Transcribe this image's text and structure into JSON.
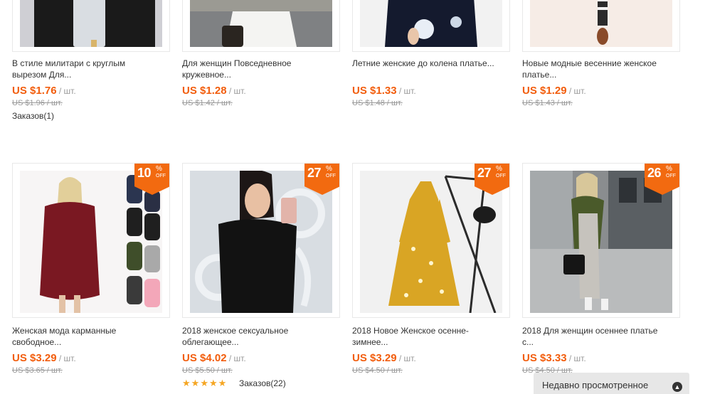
{
  "row1": [
    {
      "title": "В стиле милитари с круглым\nвырезом Для...",
      "price": "US $1.76",
      "unit": " / шт.",
      "old_price": "US $1.96 / шт.",
      "orders": "Заказов(1)"
    },
    {
      "title": "Для женщин Повседневное\nкружевное...",
      "price": "US $1.28",
      "unit": " / шт.",
      "old_price": "US $1.42 / шт."
    },
    {
      "title": "Летние женские до колена платье...",
      "price": "US $1.33",
      "unit": " / шт.",
      "old_price": "US $1.48 / шт."
    },
    {
      "title": "Новые модные весенние женское\nплатье...",
      "price": "US $1.29",
      "unit": " / шт.",
      "old_price": "US $1.43 / шт."
    }
  ],
  "row2": [
    {
      "badge_num": "10",
      "badge_pct": "%",
      "badge_off": "OFF",
      "title": "Женская мода карманные\nсвободное...",
      "price": "US $3.29",
      "unit": " / шт.",
      "old_price": "US $3.65 / шт."
    },
    {
      "badge_num": "27",
      "badge_pct": "%",
      "badge_off": "OFF",
      "title": "2018 женское сексуальное\nоблегающее...",
      "price": "US $4.02",
      "unit": " / шт.",
      "old_price": "US $5.50 / шт.",
      "rating": 5,
      "orders": "Заказов(22)"
    },
    {
      "badge_num": "27",
      "badge_pct": "%",
      "badge_off": "OFF",
      "title": "2018 Новое Женское осенне-\nзимнее...",
      "price": "US $3.29",
      "unit": " / шт.",
      "old_price": "US $4.50 / шт."
    },
    {
      "badge_num": "26",
      "badge_pct": "%",
      "badge_off": "OFF",
      "title": "2018 Для женщин осеннее платье\nс...",
      "price": "US $3.33",
      "unit": " / шт.",
      "old_price": "US $4.50 / шт."
    }
  ],
  "recently_viewed": {
    "label": "Недавно просмотренное",
    "icon": "chevron-circle-icon"
  },
  "colors": {
    "price": "#f25d0c",
    "badge": "#f26a10",
    "star": "#f5a623"
  }
}
